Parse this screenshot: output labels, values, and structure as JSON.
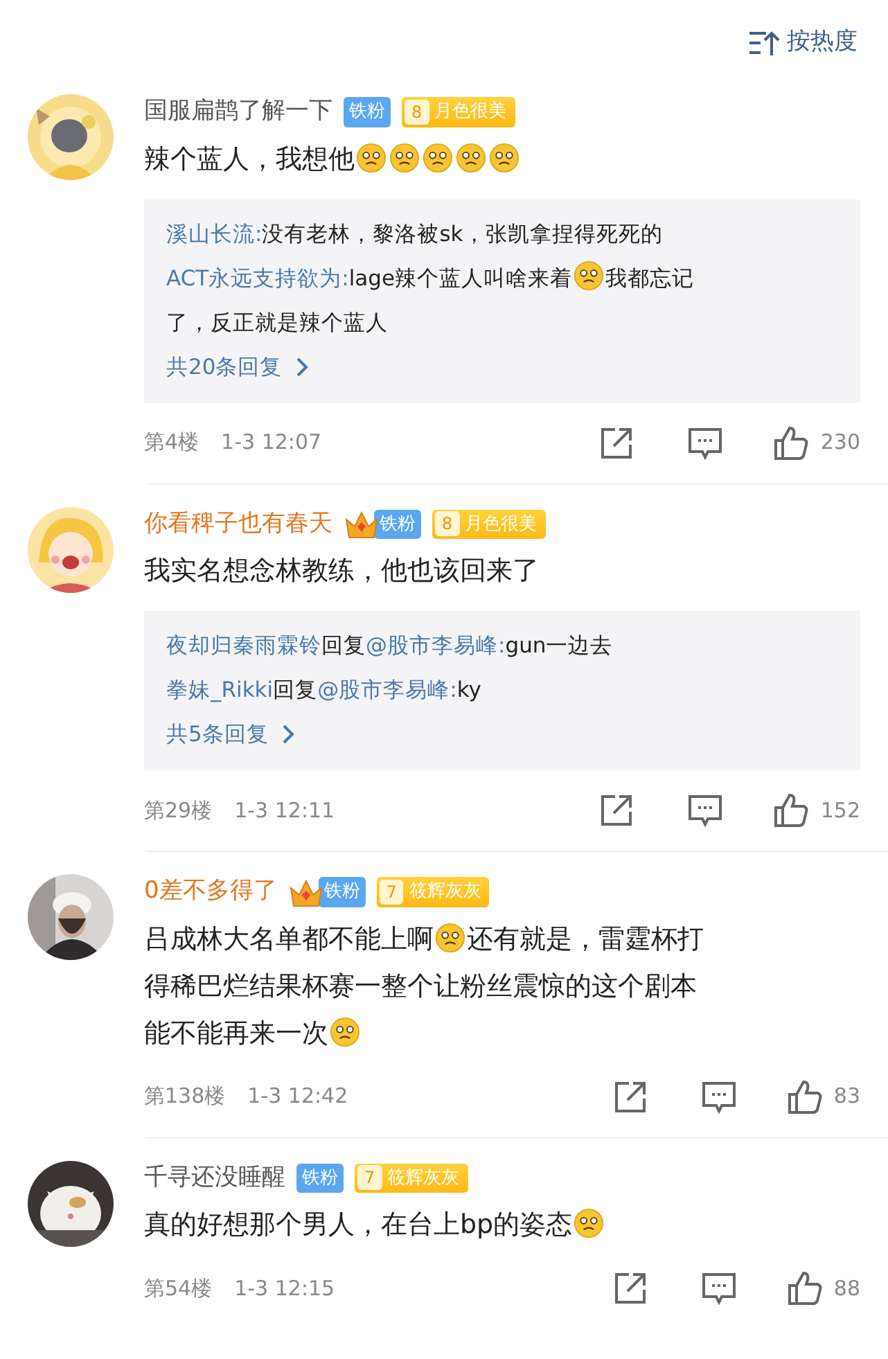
{
  "sort": {
    "label": "按热度"
  },
  "comments": [
    {
      "user": "国服扁鹊了解一下",
      "vip": false,
      "fan_badge": "铁粉",
      "level": "8",
      "level_name": "月色很美",
      "body": [
        {
          "kind": "text",
          "text": "辣个蓝人，我想他"
        },
        {
          "kind": "emoji"
        },
        {
          "kind": "emoji"
        },
        {
          "kind": "emoji"
        },
        {
          "kind": "emoji"
        },
        {
          "kind": "emoji"
        }
      ],
      "replies": [
        {
          "user": "溪山长流:",
          "content": [
            {
              "kind": "text",
              "text": "没有老林，黎洛被sk，张凯拿捏得死死的"
            }
          ]
        },
        {
          "user": "ACT永远支持欲为:",
          "content": [
            {
              "kind": "text",
              "text": "lage辣个蓝人叫啥来着"
            },
            {
              "kind": "emoji"
            },
            {
              "kind": "text",
              "text": "我都忘记"
            },
            {
              "kind": "break"
            },
            {
              "kind": "text",
              "text": "了，反正就是辣个蓝人"
            }
          ]
        }
      ],
      "more_replies": "共20条回复",
      "floor": "第4楼",
      "time": "1-3 12:07",
      "likes": "230"
    },
    {
      "user": "你看稗子也有春天",
      "vip": true,
      "fan_badge": "铁粉",
      "level": "8",
      "level_name": "月色很美",
      "body": [
        {
          "kind": "text",
          "text": "我实名想念林教练，他也该回来了"
        }
      ],
      "replies": [
        {
          "user": "夜却归秦雨霖铃",
          "action": "回复",
          "target": "@股市李易峰:",
          "content": [
            {
              "kind": "text",
              "text": "gun一边去"
            }
          ]
        },
        {
          "user": "拳妹_Rikki",
          "action": "回复",
          "target": "@股市李易峰:",
          "content": [
            {
              "kind": "text",
              "text": "ky"
            }
          ]
        }
      ],
      "more_replies": "共5条回复",
      "floor": "第29楼",
      "time": "1-3 12:11",
      "likes": "152"
    },
    {
      "user": "0差不多得了",
      "vip": true,
      "fan_badge": "铁粉",
      "level": "7",
      "level_name": "筱辉灰灰",
      "body": [
        {
          "kind": "text",
          "text": "吕成林大名单都不能上啊"
        },
        {
          "kind": "emoji"
        },
        {
          "kind": "text",
          "text": "还有就是，雷霆杯打"
        },
        {
          "kind": "break"
        },
        {
          "kind": "text",
          "text": "得稀巴烂结果杯赛一整个让粉丝震惊的这个剧本"
        },
        {
          "kind": "break"
        },
        {
          "kind": "text",
          "text": "能不能再来一次"
        },
        {
          "kind": "emoji"
        }
      ],
      "floor": "第138楼",
      "time": "1-3 12:42",
      "likes": "83"
    },
    {
      "user": "千寻还没睡醒",
      "vip": false,
      "fan_badge": "铁粉",
      "level": "7",
      "level_name": "筱辉灰灰",
      "body": [
        {
          "kind": "text",
          "text": "真的好想那个男人，在台上bp的姿态"
        },
        {
          "kind": "emoji"
        }
      ],
      "floor": "第54楼",
      "time": "1-3 12:15",
      "likes": "88"
    }
  ]
}
